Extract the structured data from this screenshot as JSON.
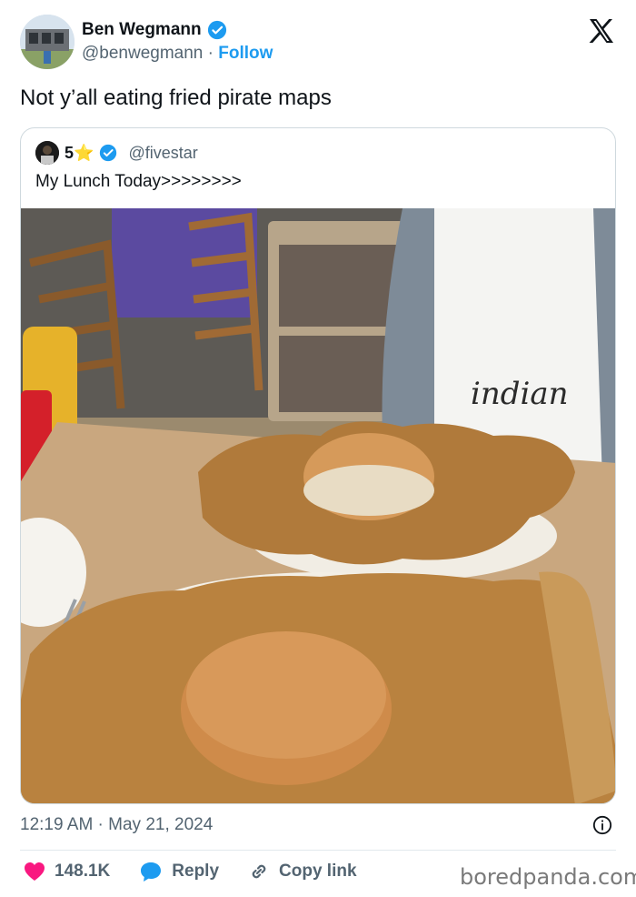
{
  "author": {
    "name": "Ben Wegmann",
    "handle": "@benwegmann",
    "separator": "·",
    "follow_label": "Follow",
    "verified_color": "#1d9bf0"
  },
  "tweet": {
    "text": "Not y’all eating fried pirate maps",
    "timestamp": "12:19 AM · May 21, 2024"
  },
  "quote": {
    "name_number": "5",
    "name_star": "⭐",
    "handle": "@fivestar",
    "text": "My Lunch Today>>>>>>>>"
  },
  "actions": {
    "likes": "148.1K",
    "reply_label": "Reply",
    "copy_link_label": "Copy link"
  },
  "watermark": "boredpanda.com",
  "colors": {
    "accent": "#1d9bf0",
    "like": "#f91880",
    "text_secondary": "#536471"
  }
}
